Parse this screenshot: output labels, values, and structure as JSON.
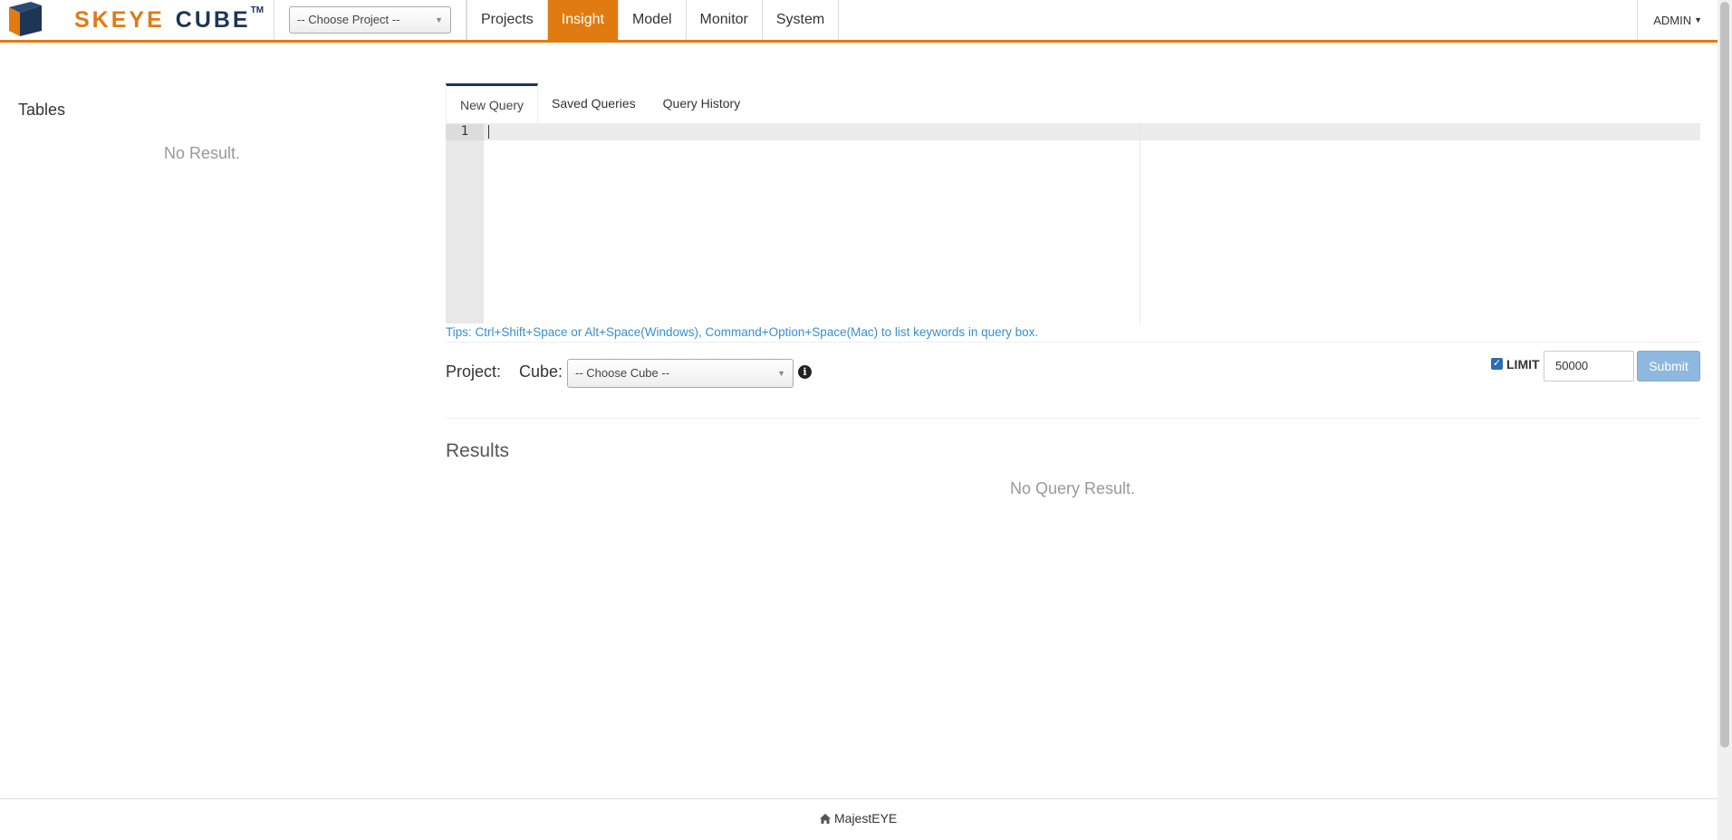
{
  "brand": {
    "word1": "SKEYE",
    "word2": "CUBE",
    "tm": "TM"
  },
  "header": {
    "project_select": "-- Choose Project --",
    "nav": [
      "Projects",
      "Insight",
      "Model",
      "Monitor",
      "System"
    ],
    "active_nav": "Insight",
    "user": "ADMIN"
  },
  "sidebar": {
    "title": "Tables",
    "empty": "No Result."
  },
  "query_tabs": [
    "New Query",
    "Saved Queries",
    "Query History"
  ],
  "editor": {
    "line_number": "1",
    "content": ""
  },
  "tips": "Tips: Ctrl+Shift+Space or Alt+Space(Windows), Command+Option+Space(Mac) to list keywords in query box.",
  "form": {
    "project_label": "Project:",
    "cube_label": "Cube:",
    "cube_select": "-- Choose Cube --",
    "limit_checked": true,
    "limit_label": "LIMIT",
    "limit_value": "50000",
    "submit_label": "Submit"
  },
  "results": {
    "title": "Results",
    "empty": "No Query Result."
  },
  "footer": {
    "link": "MajestEYE"
  },
  "colors": {
    "accent": "#e07b12",
    "navy": "#1d3557",
    "tip": "#3a8ed0",
    "submit": "#8fb8e0"
  }
}
